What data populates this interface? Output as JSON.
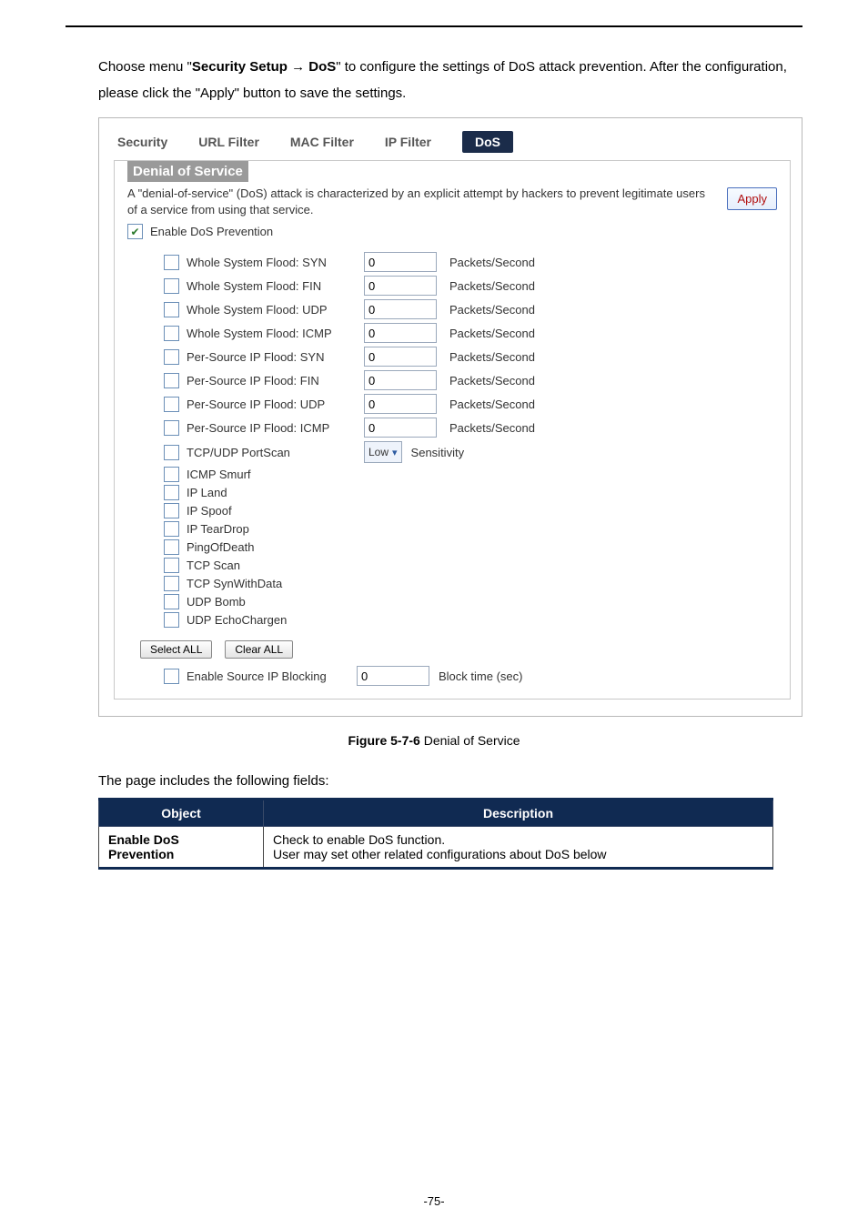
{
  "instruction": {
    "pre": "Choose menu \"",
    "menu_path": "Security Setup → DoS",
    "post": "\" to configure the settings of DoS attack prevention. After the configuration, please click the \"Apply\" button to save the settings."
  },
  "tabs": {
    "security": "Security",
    "url_filter": "URL Filter",
    "mac_filter": "MAC Filter",
    "ip_filter": "IP Filter",
    "dos": "DoS"
  },
  "dos": {
    "heading": "Denial of Service",
    "desc": "A \"denial-of-service\" (DoS) attack is characterized by an explicit attempt by hackers to prevent legitimate users of a service from using that service.",
    "apply_label": "Apply",
    "enable_checked": true,
    "enable_label": "Enable DoS Prevention",
    "unit": "Packets/Second",
    "items": [
      {
        "label": "Whole System Flood: SYN",
        "value": "0",
        "has_input": true
      },
      {
        "label": "Whole System Flood: FIN",
        "value": "0",
        "has_input": true
      },
      {
        "label": "Whole System Flood: UDP",
        "value": "0",
        "has_input": true
      },
      {
        "label": "Whole System Flood: ICMP",
        "value": "0",
        "has_input": true
      },
      {
        "label": "Per-Source IP Flood: SYN",
        "value": "0",
        "has_input": true
      },
      {
        "label": "Per-Source IP Flood: FIN",
        "value": "0",
        "has_input": true
      },
      {
        "label": "Per-Source IP Flood: UDP",
        "value": "0",
        "has_input": true
      },
      {
        "label": "Per-Source IP Flood: ICMP",
        "value": "0",
        "has_input": true
      }
    ],
    "portscan": {
      "label": "TCP/UDP PortScan",
      "sel_value": "Low",
      "sens_label": "Sensitivity"
    },
    "flags": [
      "ICMP Smurf",
      "IP Land",
      "IP Spoof",
      "IP TearDrop",
      "PingOfDeath",
      "TCP Scan",
      "TCP SynWithData",
      "UDP Bomb",
      "UDP EchoChargen"
    ],
    "select_all": "Select ALL",
    "clear_all": "Clear ALL",
    "src_block": {
      "label": "Enable Source IP Blocking",
      "value": "0",
      "unit": "Block time (sec)"
    }
  },
  "figure_caption_bold": "Figure 5-7-6",
  "figure_caption_rest": " Denial of Service",
  "fields_intro": "The page includes the following fields:",
  "table": {
    "head_object": "Object",
    "head_desc": "Description",
    "row1_obj_line1": "Enable DoS",
    "row1_obj_line2": "Prevention",
    "row1_desc_line1": "Check to enable DoS function.",
    "row1_desc_line2": "User may set other related configurations about DoS below"
  },
  "footer": "-75-"
}
